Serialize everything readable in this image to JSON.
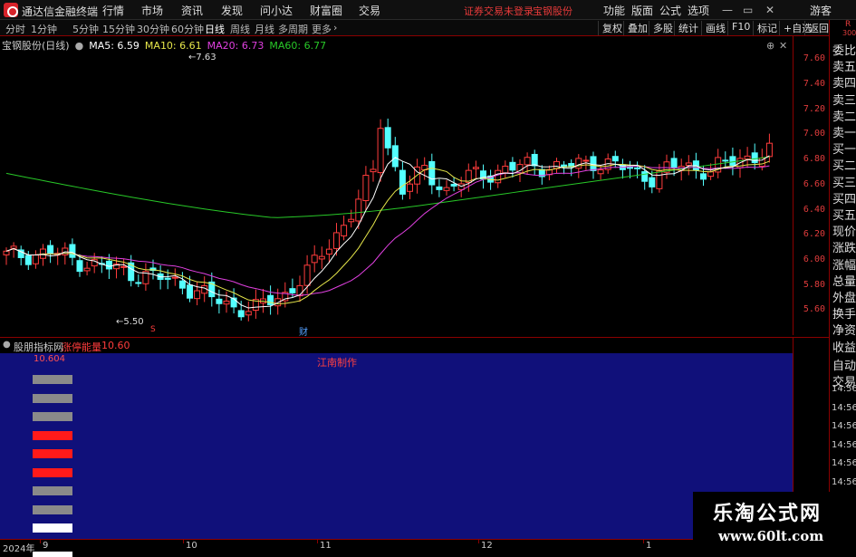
{
  "menubar": {
    "app_title": "通达信金融终端",
    "items": [
      "行情",
      "市场",
      "资讯",
      "发现",
      "问小达",
      "财富圈",
      "交易"
    ],
    "notice": "证券交易未登录",
    "stock": "宝钢股份",
    "right_items": [
      "功能",
      "版面",
      "公式",
      "选项"
    ],
    "guest": "游客"
  },
  "tabs": [
    "分时",
    "1分钟",
    "5分钟",
    "15分钟",
    "30分钟",
    "60分钟",
    "日线",
    "周线",
    "月线",
    "多周期",
    "更多"
  ],
  "active_tab": "日线",
  "right_tools": [
    "复权",
    "叠加",
    "多股",
    "统计",
    "画线",
    "F10",
    "标记",
    "+自选",
    "返回"
  ],
  "chart": {
    "stock_label": "宝钢股份(日线)",
    "ma": [
      {
        "label": "MA5: 6.59",
        "color": "#ffffff"
      },
      {
        "label": "MA10: 6.61",
        "color": "#e6e64a"
      },
      {
        "label": "MA20: 6.73",
        "color": "#e040e0"
      },
      {
        "label": "MA60: 6.77",
        "color": "#28c828"
      }
    ],
    "price_ticks": [
      "7.60",
      "7.40",
      "7.20",
      "7.00",
      "6.80",
      "6.60",
      "6.40",
      "6.20",
      "6.00",
      "5.80",
      "5.60"
    ],
    "high_note": "7.63",
    "low_note": "5.50",
    "marker_s": "S",
    "marker_cai": "财"
  },
  "indicator": {
    "name": "股朋指标网",
    "series_label": "涨停能量",
    "series_value": "10.60",
    "top_value": "10.604",
    "center_text": "江南制作"
  },
  "time_axis": [
    "2024年",
    "9",
    "10",
    "11",
    "12",
    "1"
  ],
  "sidebar": {
    "top_small": "R",
    "top_num": "300",
    "labels": [
      "委比",
      "卖五",
      "卖四",
      "卖三",
      "卖二",
      "卖一",
      "买一",
      "买二",
      "买三",
      "买四",
      "买五",
      "现价",
      "涨跌",
      "涨幅",
      "总量",
      "外盘",
      "换手",
      "净资",
      "收益",
      "自动",
      "交易"
    ],
    "times": [
      "14:56",
      "14:56",
      "14:56",
      "14:56",
      "14:56",
      "14:56",
      "14:56",
      "14:56"
    ]
  },
  "watermark": {
    "title": "乐淘公式网",
    "url": "www.60lt.com"
  },
  "colors": {
    "up": "#ff3c3c",
    "down": "#54ffff",
    "ma5": "#ffffff",
    "ma10": "#e6e64a",
    "ma20": "#e040e0",
    "ma60": "#28c828",
    "indicator_bg": "#10107a"
  },
  "indicator_bars": [
    "gray",
    "gray",
    "gray",
    "red",
    "red",
    "red",
    "gray",
    "gray",
    "white",
    "white"
  ]
}
